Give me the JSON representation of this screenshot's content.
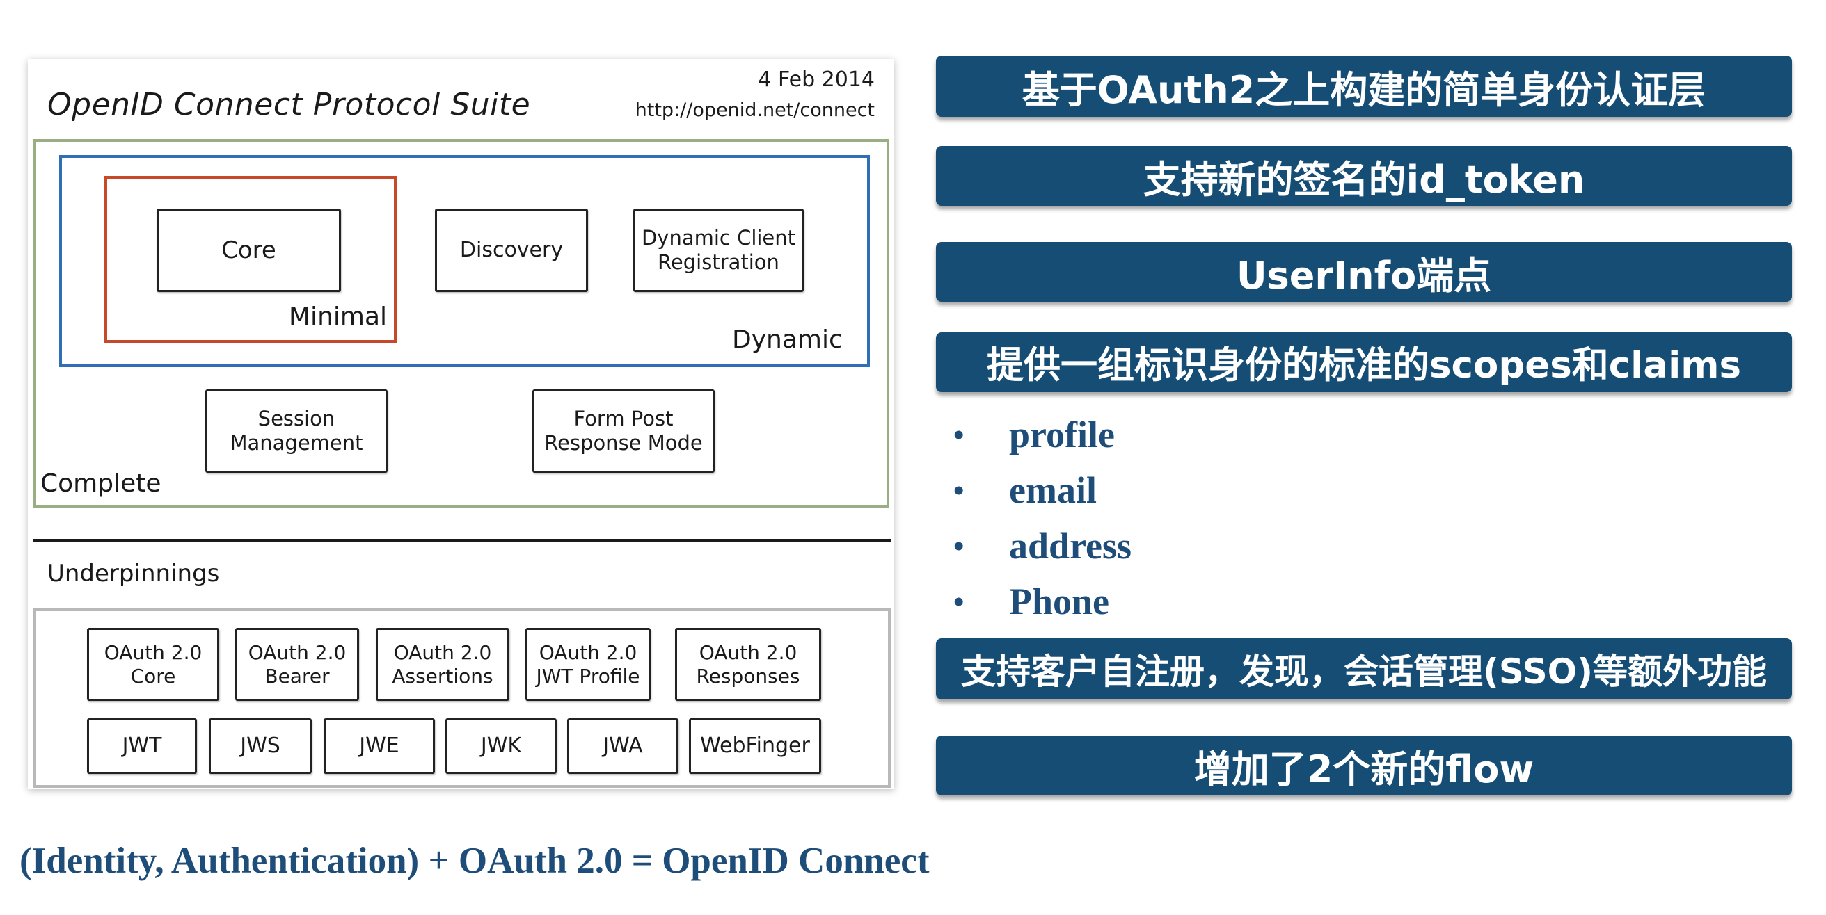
{
  "diagram": {
    "title": "OpenID Connect Protocol Suite",
    "date": "4 Feb 2014",
    "url": "http://openid.net/connect",
    "boxes": {
      "core": "Core",
      "discovery": "Discovery",
      "dynamic_client_registration_line1": "Dynamic Client",
      "dynamic_client_registration_line2": "Registration",
      "session_line1": "Session",
      "session_line2": "Management",
      "formpost_line1": "Form Post",
      "formpost_line2": "Response Mode"
    },
    "labels": {
      "minimal": "Minimal",
      "dynamic": "Dynamic",
      "complete": "Complete",
      "underpinnings": "Underpinnings"
    },
    "underpinnings_row1": [
      {
        "line1": "OAuth 2.0",
        "line2": "Core"
      },
      {
        "line1": "OAuth 2.0",
        "line2": "Bearer"
      },
      {
        "line1": "OAuth 2.0",
        "line2": "Assertions"
      },
      {
        "line1": "OAuth 2.0",
        "line2": "JWT Profile"
      },
      {
        "line1": "OAuth 2.0",
        "line2": "Responses"
      }
    ],
    "underpinnings_row2": [
      "JWT",
      "JWS",
      "JWE",
      "JWK",
      "JWA",
      "WebFinger"
    ],
    "colors": {
      "complete_frame": "#9aae84",
      "dynamic_frame": "#2e6fb7",
      "minimal_frame": "#c64a2a"
    }
  },
  "banners": [
    "基于OAuth2之上构建的简单身份认证层",
    "支持新的签名的id_token",
    "UserInfo端点",
    "提供一组标识身份的标准的scopes和claims",
    "支持客户自注册，发现，会话管理(SSO)等额外功能",
    "增加了2个新的flow"
  ],
  "bullet_char": "•",
  "bullets": [
    "profile",
    "email",
    "address",
    "Phone"
  ],
  "formula": "(Identity, Authentication) + OAuth 2.0 = OpenID Connect",
  "colors": {
    "banner_bg": "#154d75",
    "text_blue": "#1d4d78"
  }
}
